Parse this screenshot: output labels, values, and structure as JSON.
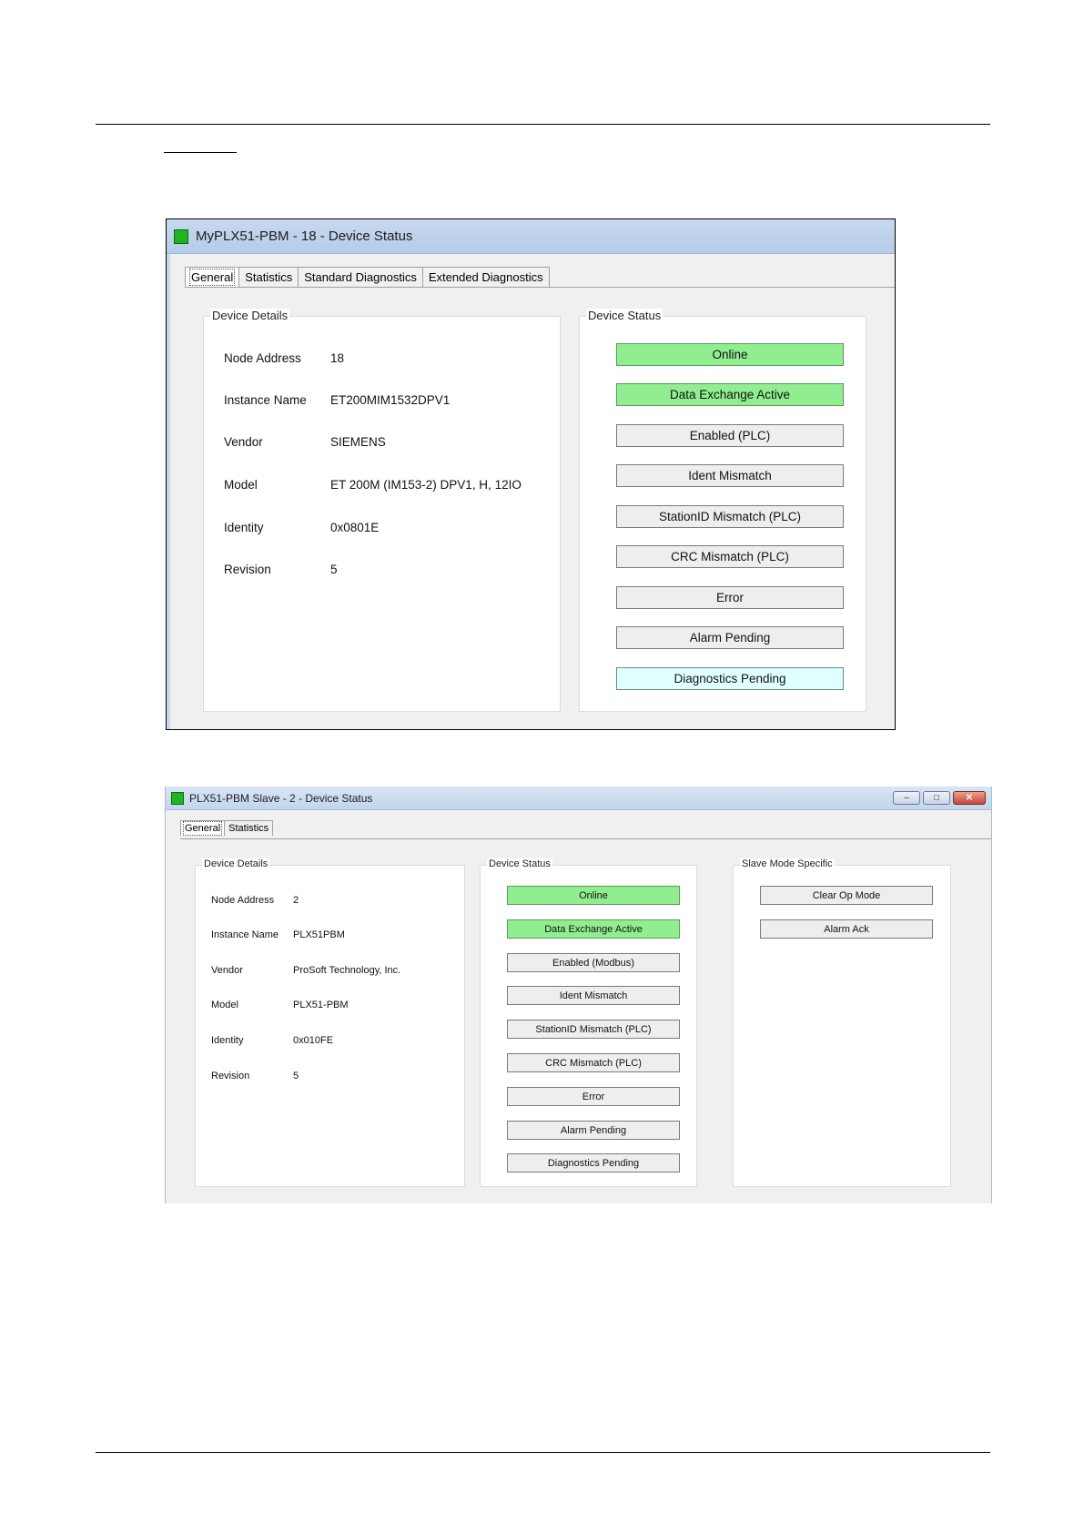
{
  "window1": {
    "title": "MyPLX51-PBM - 18 - Device Status",
    "tabs": [
      {
        "label": "General",
        "active": true
      },
      {
        "label": "Statistics",
        "active": false
      },
      {
        "label": "Standard Diagnostics",
        "active": false
      },
      {
        "label": "Extended Diagnostics",
        "active": false
      }
    ],
    "device_details": {
      "title": "Device Details",
      "rows": [
        {
          "label": "Node Address",
          "value": "18"
        },
        {
          "label": "Instance Name",
          "value": "ET200MIM1532DPV1"
        },
        {
          "label": "Vendor",
          "value": "SIEMENS"
        },
        {
          "label": "Model",
          "value": "ET 200M (IM153-2) DPV1, H, 12IO"
        },
        {
          "label": "Identity",
          "value": "0x0801E"
        },
        {
          "label": "Revision",
          "value": "5"
        }
      ]
    },
    "device_status": {
      "title": "Device Status",
      "buttons": [
        {
          "label": "Online",
          "state": "green"
        },
        {
          "label": "Data Exchange Active",
          "state": "green"
        },
        {
          "label": "Enabled (PLC)",
          "state": "off"
        },
        {
          "label": "Ident Mismatch",
          "state": "off"
        },
        {
          "label": "StationID Mismatch (PLC)",
          "state": "off"
        },
        {
          "label": "CRC Mismatch (PLC)",
          "state": "off"
        },
        {
          "label": "Error",
          "state": "off"
        },
        {
          "label": "Alarm Pending",
          "state": "off"
        },
        {
          "label": "Diagnostics Pending",
          "state": "cyan"
        }
      ]
    }
  },
  "window2": {
    "title": "PLX51-PBM Slave - 2 - Device Status",
    "window_buttons": {
      "minimize": "–",
      "maximize": "□",
      "close": "✕"
    },
    "tabs": [
      {
        "label": "General",
        "active": true
      },
      {
        "label": "Statistics",
        "active": false
      }
    ],
    "device_details": {
      "title": "Device Details",
      "rows": [
        {
          "label": "Node Address",
          "value": "2"
        },
        {
          "label": "Instance Name",
          "value": "PLX51PBM"
        },
        {
          "label": "Vendor",
          "value": "ProSoft Technology, Inc."
        },
        {
          "label": "Model",
          "value": "PLX51-PBM"
        },
        {
          "label": "Identity",
          "value": "0x010FE"
        },
        {
          "label": "Revision",
          "value": "5"
        }
      ]
    },
    "device_status": {
      "title": "Device Status",
      "buttons": [
        {
          "label": "Online",
          "state": "green"
        },
        {
          "label": "Data Exchange Active",
          "state": "green"
        },
        {
          "label": "Enabled (Modbus)",
          "state": "off"
        },
        {
          "label": "Ident Mismatch",
          "state": "off"
        },
        {
          "label": "StationID Mismatch (PLC)",
          "state": "off"
        },
        {
          "label": "CRC Mismatch (PLC)",
          "state": "off"
        },
        {
          "label": "Error",
          "state": "off"
        },
        {
          "label": "Alarm Pending",
          "state": "off"
        },
        {
          "label": "Diagnostics Pending",
          "state": "off"
        }
      ]
    },
    "slave_mode": {
      "title": "Slave Mode Specific",
      "buttons": [
        {
          "label": "Clear Op Mode"
        },
        {
          "label": "Alarm Ack"
        }
      ]
    }
  }
}
